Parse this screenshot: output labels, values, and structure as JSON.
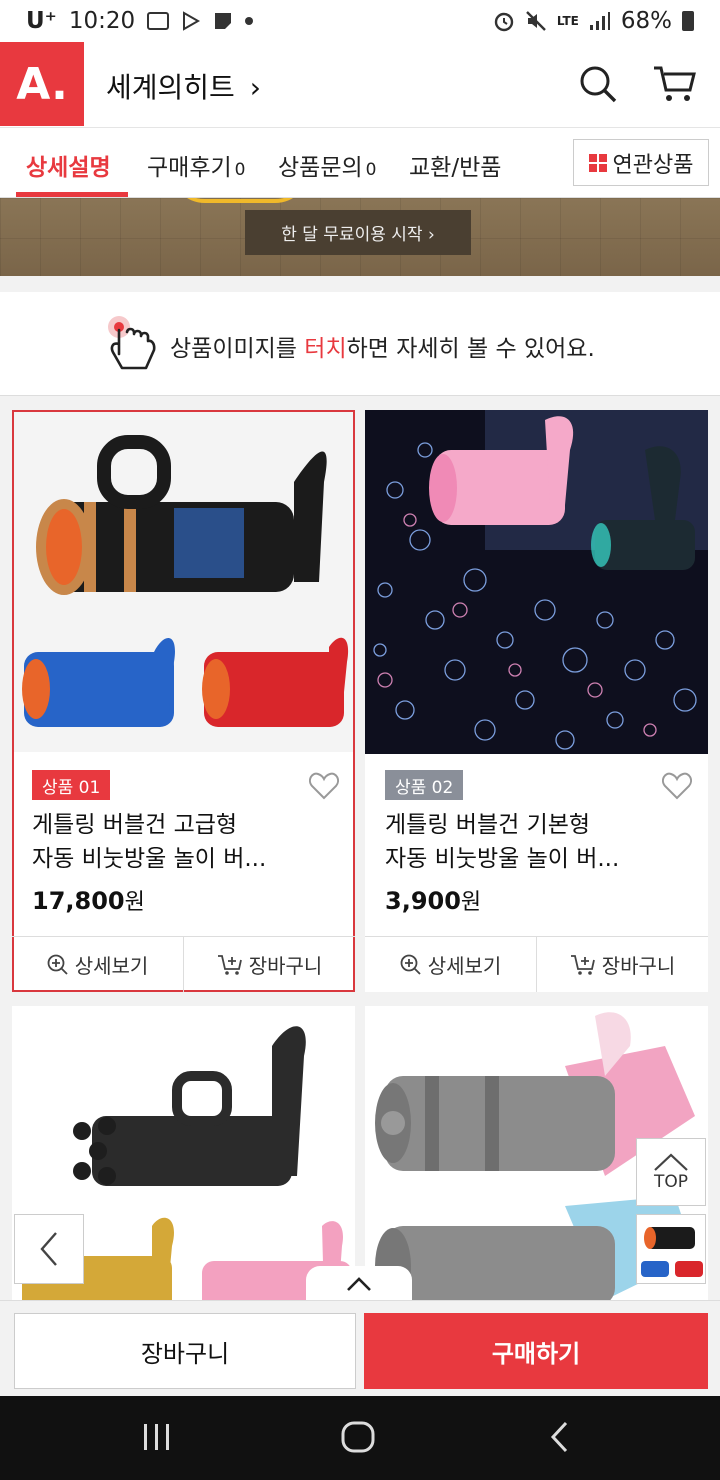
{
  "status_bar": {
    "carrier": "U⁺",
    "time": "10:20",
    "network": "LTE",
    "battery": "68%"
  },
  "header": {
    "logo_text": "A.",
    "store_name": "세계의히트",
    "store_chevron": "›"
  },
  "tabs": [
    {
      "label": "상세설명",
      "count": ""
    },
    {
      "label": "구매후기",
      "count": "0"
    },
    {
      "label": "상품문의",
      "count": "0"
    },
    {
      "label": "교환/반품",
      "count": ""
    }
  ],
  "related_button": "연관상품",
  "banner": {
    "button_label": "한 달 무료이용 시작 ›"
  },
  "hint": {
    "before": "상품이미지를 ",
    "highlight": "터치",
    "after": "하면 자세히 볼 수 있어요."
  },
  "products": [
    {
      "badge": "상품 01",
      "name_line1": "게틀링 버블건 고급형",
      "name_line2": "자동 비눗방울 놀이 버...",
      "price": "17,800",
      "currency": "원",
      "detail_label": "상세보기",
      "cart_label": "장바구니"
    },
    {
      "badge": "상품 02",
      "name_line1": "게틀링 버블건 기본형",
      "name_line2": "자동 비눗방울 놀이 버...",
      "price": "3,900",
      "currency": "원",
      "detail_label": "상세보기",
      "cart_label": "장바구니"
    }
  ],
  "floating": {
    "top_label": "TOP"
  },
  "bottom_bar": {
    "cart_label": "장바구니",
    "buy_label": "구매하기"
  },
  "colors": {
    "accent": "#e8393f",
    "badge_gray": "#8a8f99"
  }
}
